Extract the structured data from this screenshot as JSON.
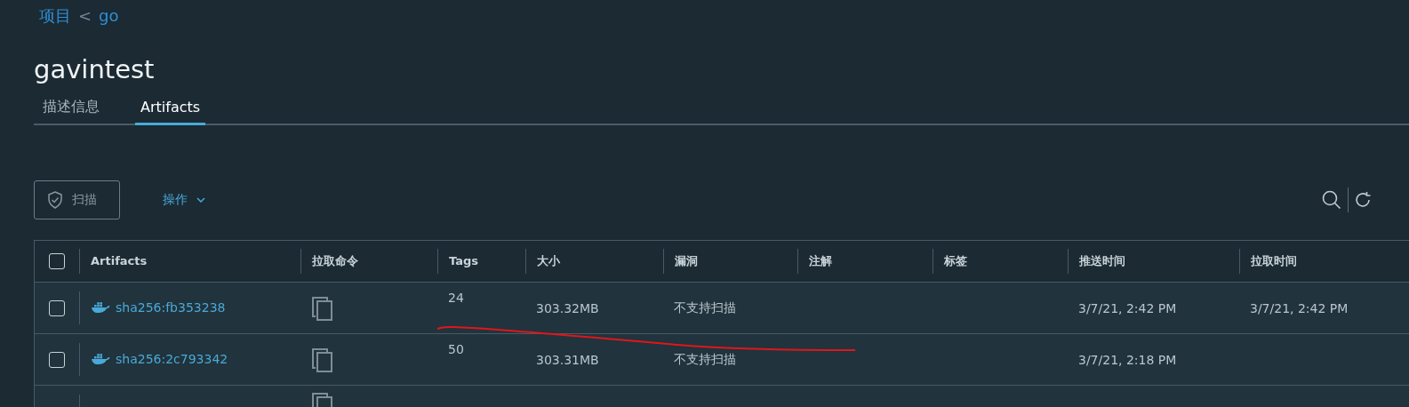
{
  "breadcrumb": {
    "parent": "项目",
    "separator": "<",
    "current": "go"
  },
  "title": "gavintest",
  "tabs": [
    {
      "label": "描述信息",
      "selected": false
    },
    {
      "label": "Artifacts",
      "selected": true
    }
  ],
  "toolbar": {
    "scan_button": {
      "label": "扫描",
      "disabled": true
    },
    "actions_menu": {
      "label": "操作"
    }
  },
  "table": {
    "columns": [
      "Artifacts",
      "拉取命令",
      "Tags",
      "大小",
      "漏洞",
      "注解",
      "标签",
      "推送时间",
      "拉取时间"
    ],
    "select_all_checked": false,
    "rows": [
      {
        "checked": false,
        "digest": "sha256:fb353238",
        "tags": "24",
        "size": "303.32MB",
        "vulnerabilities": "不支持扫描",
        "push_time": "3/7/21, 2:42 PM",
        "pull_time": "3/7/21, 2:42 PM"
      },
      {
        "checked": false,
        "digest": "sha256:2c793342",
        "tags": "50",
        "size": "303.31MB",
        "vulnerabilities": "不支持扫描",
        "push_time": "3/7/21, 2:18 PM"
      }
    ]
  }
}
